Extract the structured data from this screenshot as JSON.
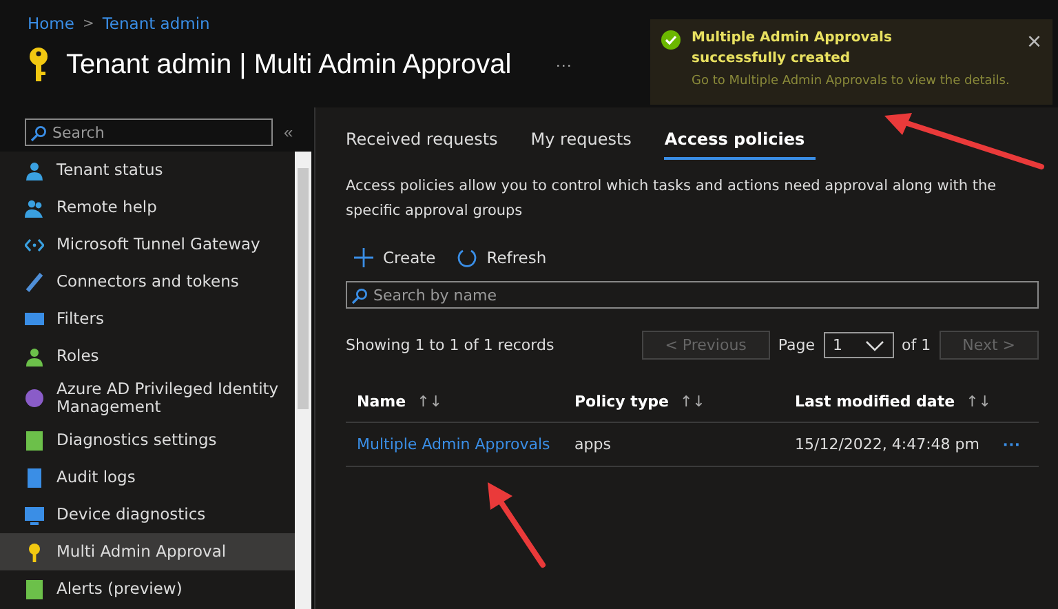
{
  "breadcrumb": [
    "Home",
    "Tenant admin"
  ],
  "breadcrumb_separator": ">",
  "page_title": "Tenant admin | Multi Admin Approval",
  "more": "···",
  "toast": {
    "title": "Multiple Admin Approvals successfully created",
    "message": "Go to Multiple Admin Approvals to view the details.",
    "close": "×"
  },
  "sidebar": {
    "search": {
      "placeholder": "Search"
    },
    "collapse": "«",
    "items": [
      {
        "label": "Tenant status",
        "kind": "person",
        "color": "#3aa0e0",
        "selected": false
      },
      {
        "label": "Remote help",
        "kind": "people",
        "color": "#3aa0e0",
        "selected": false
      },
      {
        "label": "Microsoft Tunnel Gateway",
        "kind": "code",
        "color": "#3aa0e0",
        "selected": false
      },
      {
        "label": "Connectors and tokens",
        "kind": "plug",
        "color": "#4f8fd8",
        "selected": false
      },
      {
        "label": "Filters",
        "kind": "filter",
        "color": "#3a8ee6",
        "selected": false
      },
      {
        "label": "Roles",
        "kind": "person",
        "color": "#6cc04a",
        "selected": false
      },
      {
        "label": "Azure AD Privileged Identity Management",
        "kind": "circle",
        "color": "#8a5cc8",
        "selected": false
      },
      {
        "label": "Diagnostics settings",
        "kind": "square",
        "color": "#6cc04a",
        "selected": false
      },
      {
        "label": "Audit logs",
        "kind": "doc",
        "color": "#3a8ee6",
        "selected": false
      },
      {
        "label": "Device diagnostics",
        "kind": "monitor",
        "color": "#3a8ee6",
        "selected": false
      },
      {
        "label": "Multi Admin Approval",
        "kind": "key",
        "color": "#f2c811",
        "selected": true
      },
      {
        "label": "Alerts (preview)",
        "kind": "square",
        "color": "#6cc04a",
        "selected": false
      }
    ]
  },
  "tabs": [
    {
      "label": "Received requests",
      "selected": false
    },
    {
      "label": "My requests",
      "selected": false
    },
    {
      "label": "Access policies",
      "selected": true
    }
  ],
  "description": "Access policies allow you to control which tasks and actions need approval along with the specific approval groups",
  "toolbar": [
    {
      "label": "Create",
      "kind": "create"
    },
    {
      "label": "Refresh",
      "kind": "refresh"
    }
  ],
  "filter": {
    "placeholder": "Search by name"
  },
  "records": "Showing 1 to 1 of 1 records",
  "pager": {
    "previous": {
      "label": "< Previous",
      "disabled": true
    },
    "page_label": "Page",
    "page": "1",
    "of": "of 1",
    "next": {
      "label": "Next >",
      "disabled": true
    }
  },
  "table": {
    "columns": [
      {
        "label": "Name",
        "sort": "↑↓"
      },
      {
        "label": "Policy type",
        "sort": "↑↓"
      },
      {
        "label": "Last modified date",
        "sort": "↑↓"
      }
    ],
    "rows": [
      {
        "name": "Multiple Admin Approvals",
        "policy_type": "apps",
        "modified": "15/12/2022, 4:47:48 pm",
        "actions": "···"
      }
    ]
  }
}
